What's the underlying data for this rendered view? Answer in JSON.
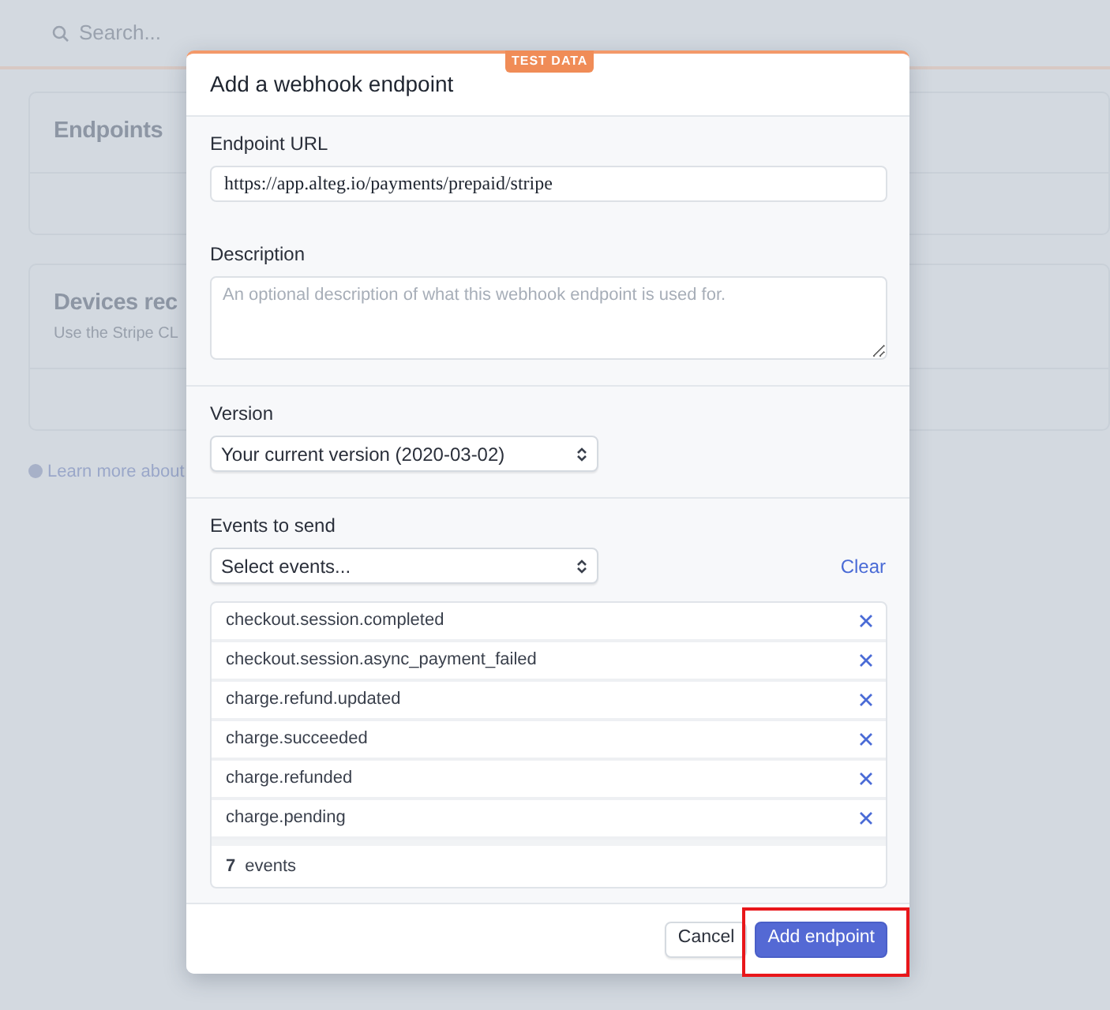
{
  "background": {
    "search": {
      "placeholder": "Search..."
    },
    "cards": [
      {
        "title": "Endpoints"
      },
      {
        "title": "Devices rec",
        "subtitle": "Use the Stripe CL"
      }
    ],
    "help_link": "Learn more about"
  },
  "modal": {
    "title": "Add a webhook endpoint",
    "badge": "TEST DATA",
    "url": {
      "label": "Endpoint URL",
      "value": "https://app.alteg.io/payments/prepaid/stripe"
    },
    "description": {
      "label": "Description",
      "placeholder": "An optional description of what this webhook endpoint is used for."
    },
    "version": {
      "label": "Version",
      "value": "Your current version (2020-03-02)"
    },
    "events": {
      "label": "Events to send",
      "select": "Select events...",
      "clear": "Clear",
      "items": [
        {
          "name": "checkout.session.completed"
        },
        {
          "name": "checkout.session.async_payment_failed"
        },
        {
          "name": "charge.refund.updated"
        },
        {
          "name": "charge.succeeded"
        },
        {
          "name": "charge.refunded"
        },
        {
          "name": "charge.pending"
        }
      ],
      "count": "7",
      "count_label": "events"
    },
    "buttons": [
      {
        "label": "Cancel",
        "kind": "secondary",
        "highlighted": false
      },
      {
        "label": "Add endpoint",
        "kind": "primary",
        "highlighted": true
      }
    ]
  }
}
